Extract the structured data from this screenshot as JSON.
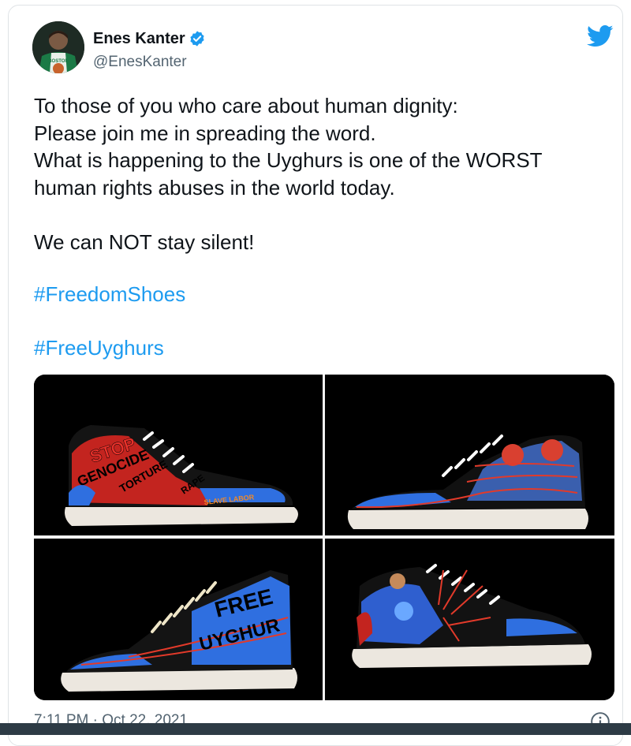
{
  "author": {
    "display_name": "Enes Kanter",
    "handle": "@EnesKanter",
    "jersey_text": "BOSTON"
  },
  "tweet": {
    "text": "To those of you who care about human dignity:\nPlease join me in spreading the word.\nWhat is happening to the Uyghurs is one of the WORST\nhuman rights abuses in the world today.\n\nWe can NOT stay silent!",
    "hashtags": [
      "#FreedomShoes",
      "#FreeUyghurs"
    ],
    "timestamp": "7:11 PM · Oct 22, 2021"
  },
  "media": {
    "shoe_1_words": [
      "STOP",
      "GENOCIDE",
      "TORTURE",
      "RAPE",
      "SLAVE LABOR"
    ],
    "shoe_3_words": [
      "FREE",
      "UYGHUR"
    ]
  },
  "icons": {
    "verified": "verified-badge-icon",
    "twitter": "twitter-bird-icon",
    "info": "info-icon"
  },
  "colors": {
    "link": "#1d9bf0",
    "secondary_text": "#536471",
    "verified": "#1d9bf0"
  }
}
